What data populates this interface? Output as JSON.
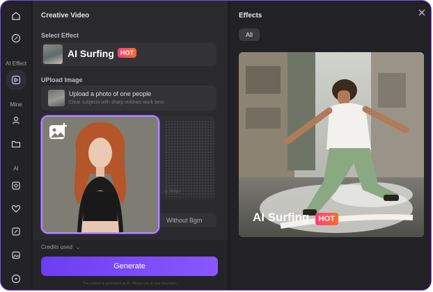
{
  "left": {
    "title": "Creative Video",
    "select_effect_label": "Select Effect",
    "effect_name": "AI Surfing",
    "effect_badge": "HOT",
    "upload_label": "UPload Image",
    "upload_title": "Upload a photo of one people",
    "upload_subtitle": "Clear subjects with sharp outlines work best",
    "resolution_hint": "…zy 360px",
    "bgm_label": "Without Bgm",
    "credits_label": "Credits used",
    "generate_label": "Generate",
    "disclaimer": "The content is generated by AI. Please use at your discretion."
  },
  "sidebar": {
    "section_effect": "AI Effect",
    "section_mine": "Mine",
    "section_ai": "AI"
  },
  "right": {
    "title": "Effects",
    "filter_all": "All",
    "preview_title": "AI Surfing",
    "preview_badge": "HOT"
  },
  "colors": {
    "accent": "#7b4df2",
    "hot_start": "#ff3e7a",
    "hot_end": "#ff6a2a",
    "panel": "#2a2a2d"
  }
}
